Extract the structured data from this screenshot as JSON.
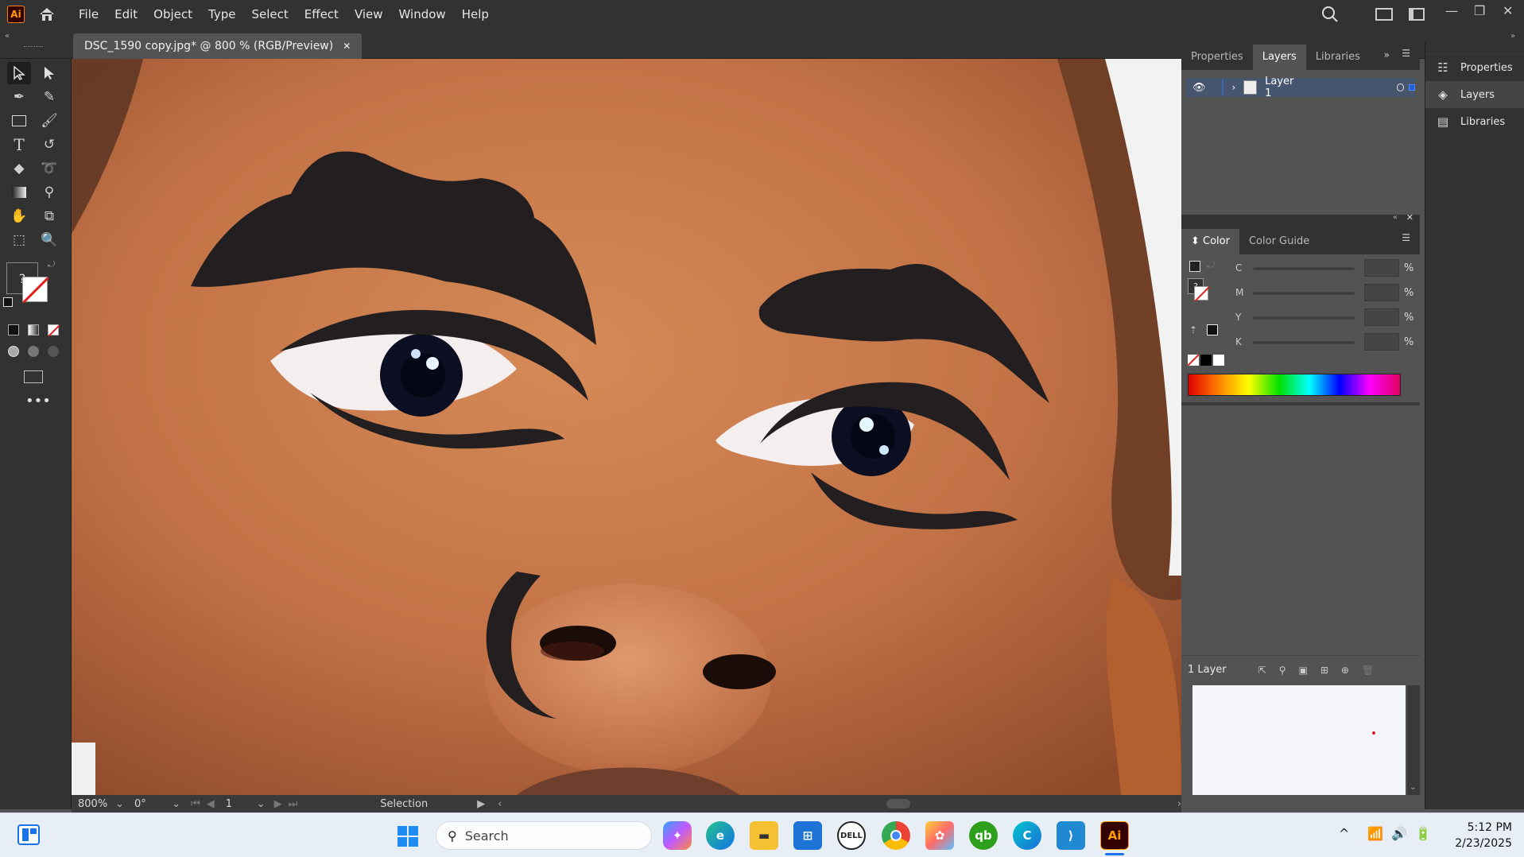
{
  "app": {
    "logo": "Ai"
  },
  "menu": [
    "File",
    "Edit",
    "Object",
    "Type",
    "Select",
    "Effect",
    "View",
    "Window",
    "Help"
  ],
  "document": {
    "tab_title": "DSC_1590 copy.jpg* @ 800 % (RGB/Preview)",
    "close": "✕"
  },
  "status": {
    "zoom": "800%",
    "rotation": "0°",
    "artboard": "1",
    "tool": "Selection"
  },
  "panels": {
    "top_tabs": [
      "Properties",
      "Layers",
      "Libraries"
    ],
    "active_top_tab": "Layers",
    "layers": [
      {
        "name": "Layer 1"
      }
    ],
    "layer_count": "1 Layer",
    "color_tabs": [
      "Color",
      "Color Guide"
    ],
    "active_color_tab": "Color",
    "cmyk": [
      {
        "label": "C",
        "value": ""
      },
      {
        "label": "M",
        "value": ""
      },
      {
        "label": "Y",
        "value": ""
      },
      {
        "label": "K",
        "value": ""
      }
    ],
    "percent": "%"
  },
  "right_dock": [
    {
      "label": "Properties",
      "icon": "properties-icon"
    },
    {
      "label": "Layers",
      "icon": "layers-icon"
    },
    {
      "label": "Libraries",
      "icon": "libraries-icon"
    }
  ],
  "taskbar": {
    "search_placeholder": "Search",
    "time": "5:12 PM",
    "date": "2/23/2025"
  },
  "colors": {
    "accent": "#ff9a00",
    "selection": "#3b6bb5",
    "skin": "#c87a4c",
    "drawn_path": "#231f20"
  }
}
